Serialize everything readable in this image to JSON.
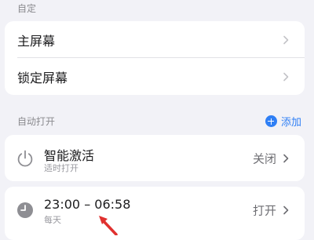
{
  "sections": {
    "customize": {
      "header": "自定"
    },
    "auto_open": {
      "header": "自动打开",
      "add_label": "添加"
    }
  },
  "customize_items": [
    {
      "label": "主屏幕"
    },
    {
      "label": "锁定屏幕"
    }
  ],
  "auto_items": [
    {
      "title": "智能激活",
      "subtitle": "适时打开",
      "status": "关闭",
      "icon": "power-icon"
    },
    {
      "title": "23:00 – 06:58",
      "subtitle": "每天",
      "status": "打开",
      "icon": "clock-icon"
    }
  ],
  "colors": {
    "accent": "#2f7ff5",
    "annotation_arrow": "#e0312f"
  }
}
